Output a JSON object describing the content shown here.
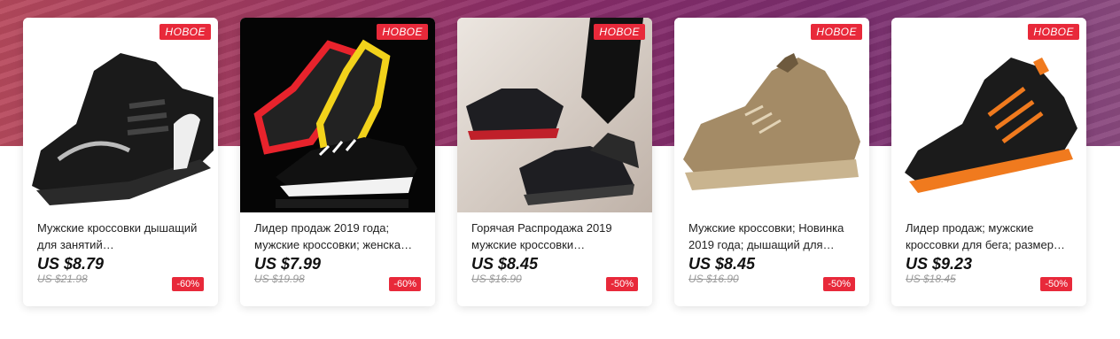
{
  "products": [
    {
      "badge": "НОВОЕ",
      "title": "Мужские кроссовки дышащий для занятий…",
      "price": "US $8.79",
      "old_price": "US $21.98",
      "discount": "-60%",
      "image_bg": "#ffffff",
      "shoe_color": "#1a1a1a",
      "accent_color": "#ffffff"
    },
    {
      "badge": "НОВОЕ",
      "title": "Лидер продаж 2019 года; мужские кроссовки; женска…",
      "price": "US $7.99",
      "old_price": "US $19.98",
      "discount": "-60%",
      "image_bg": "#050505",
      "shoe_color": "#111111",
      "accent_color": "#e8232c"
    },
    {
      "badge": "НОВОЕ",
      "title": "Горячая Распродажа 2019 мужские кроссовки…",
      "price": "US $8.45",
      "old_price": "US $16.90",
      "discount": "-50%",
      "image_bg": "#d8cfc8",
      "shoe_color": "#1e1e22",
      "accent_color": "#c0202a"
    },
    {
      "badge": "НОВОЕ",
      "title": "Мужские кроссовки; Новинка 2019 года; дышащий для…",
      "price": "US $8.45",
      "old_price": "US $16.90",
      "discount": "-50%",
      "image_bg": "#ffffff",
      "shoe_color": "#a48b66",
      "accent_color": "#c9b48f"
    },
    {
      "badge": "НОВОЕ",
      "title": "Лидер продаж; мужские кроссовки для бега; размер…",
      "price": "US $9.23",
      "old_price": "US $18.45",
      "discount": "-50%",
      "image_bg": "#ffffff",
      "shoe_color": "#1b1b1b",
      "accent_color": "#f07a1e"
    }
  ]
}
